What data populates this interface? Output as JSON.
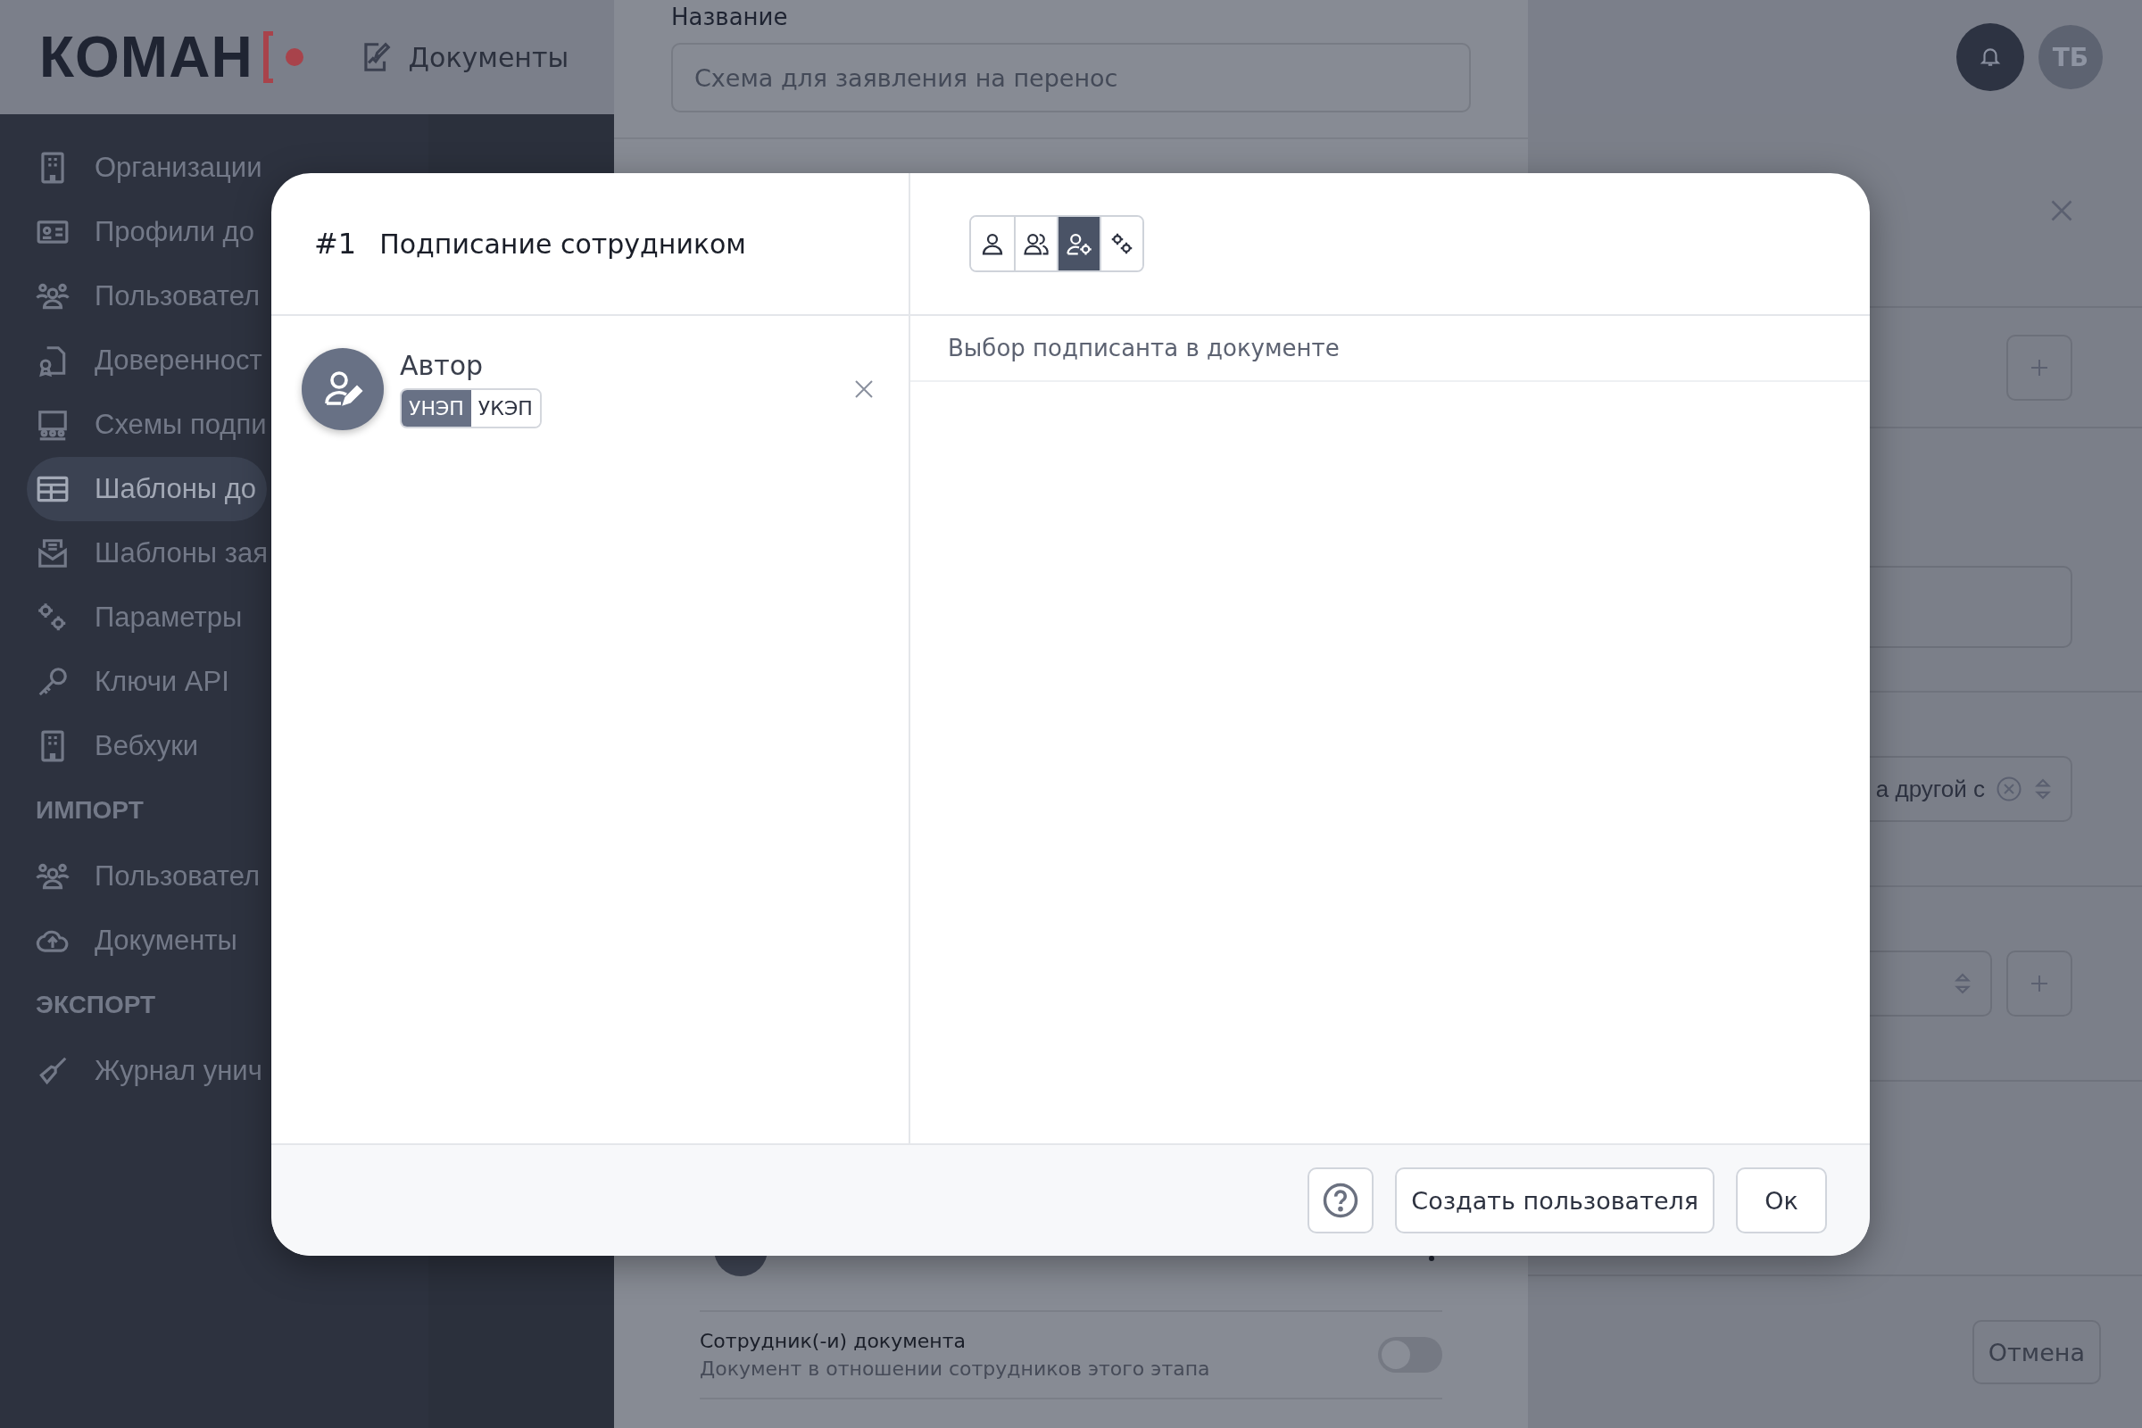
{
  "header": {
    "logo": "КОМАН",
    "nav_link": "Документы",
    "avatar_initials": "ТБ"
  },
  "sidebar": {
    "sections": [
      {
        "items": [
          {
            "label": "Организации",
            "selected": false
          },
          {
            "label": "Профили до",
            "selected": false
          },
          {
            "label": "Пользовател",
            "selected": false
          },
          {
            "label": "Доверенност",
            "selected": false
          },
          {
            "label": "Схемы подпи",
            "selected": false
          },
          {
            "label": "Шаблоны до",
            "selected": true
          },
          {
            "label": "Шаблоны зая",
            "selected": false
          },
          {
            "label": "Параметры",
            "selected": false
          },
          {
            "label": "Ключи API",
            "selected": false
          },
          {
            "label": "Вебхуки",
            "selected": false
          }
        ]
      },
      {
        "heading": "ИМПОРТ",
        "items": [
          {
            "label": "Пользовател",
            "selected": false
          },
          {
            "label": "Документы",
            "selected": false
          }
        ]
      },
      {
        "heading": "ЭКСПОРТ",
        "items": [
          {
            "label": "Журнал унич",
            "selected": false
          }
        ]
      }
    ]
  },
  "drawer": {
    "name_label": "Название",
    "name_value": "Схема для заявления на перенос",
    "employee_toggle": {
      "label": "Сотрудник(-и) документа",
      "description": "Документ в отношении сотрудников этого этапа",
      "on": false
    }
  },
  "right_panel": {
    "select_value": "а другой с",
    "cancel_button": "Отмена"
  },
  "modal": {
    "step_number": "#1",
    "title": "Подписание сотрудником",
    "signer_modes": [
      {
        "selected": false
      },
      {
        "selected": false
      },
      {
        "selected": true
      },
      {
        "selected": false
      }
    ],
    "signer": {
      "name": "Автор",
      "signature_types": [
        {
          "label": "УНЭП",
          "selected": true
        },
        {
          "label": "УКЭП",
          "selected": false
        }
      ]
    },
    "mode_description": "Выбор подписанта в документе",
    "create_user_button": "Создать пользователя",
    "ok_button": "Ок"
  }
}
